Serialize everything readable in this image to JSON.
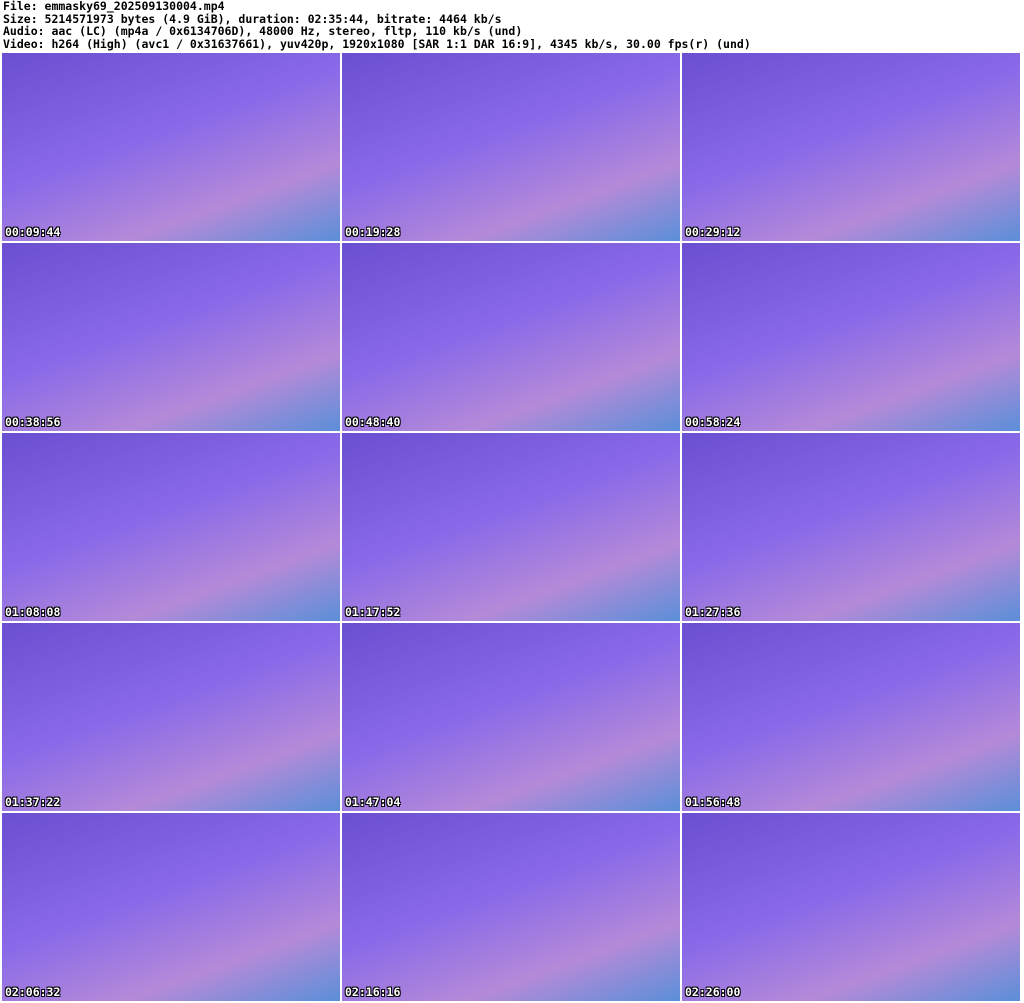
{
  "header": {
    "file": "File: emmasky69_202509130004.mp4",
    "size": "Size: 5214571973 bytes (4.9 GiB), duration: 02:35:44, bitrate: 4464 kb/s",
    "audio": "Audio: aac (LC) (mp4a / 0x6134706D), 48000 Hz, stereo, fltp, 110 kb/s (und)",
    "video": "Video: h264 (High) (avc1 / 0x31637661), yuv420p, 1920x1080 [SAR 1:1 DAR 16:9], 4345 kb/s, 30.00 fps(r) (und)"
  },
  "thumbnails": [
    {
      "time": "00:09:44"
    },
    {
      "time": "00:19:28"
    },
    {
      "time": "00:29:12"
    },
    {
      "time": "00:38:56"
    },
    {
      "time": "00:48:40"
    },
    {
      "time": "00:58:24"
    },
    {
      "time": "01:08:08"
    },
    {
      "time": "01:17:52"
    },
    {
      "time": "01:27:36"
    },
    {
      "time": "01:37:22"
    },
    {
      "time": "01:47:04"
    },
    {
      "time": "01:56:48"
    },
    {
      "time": "02:06:32"
    },
    {
      "time": "02:16:16"
    },
    {
      "time": "02:26:00"
    }
  ]
}
